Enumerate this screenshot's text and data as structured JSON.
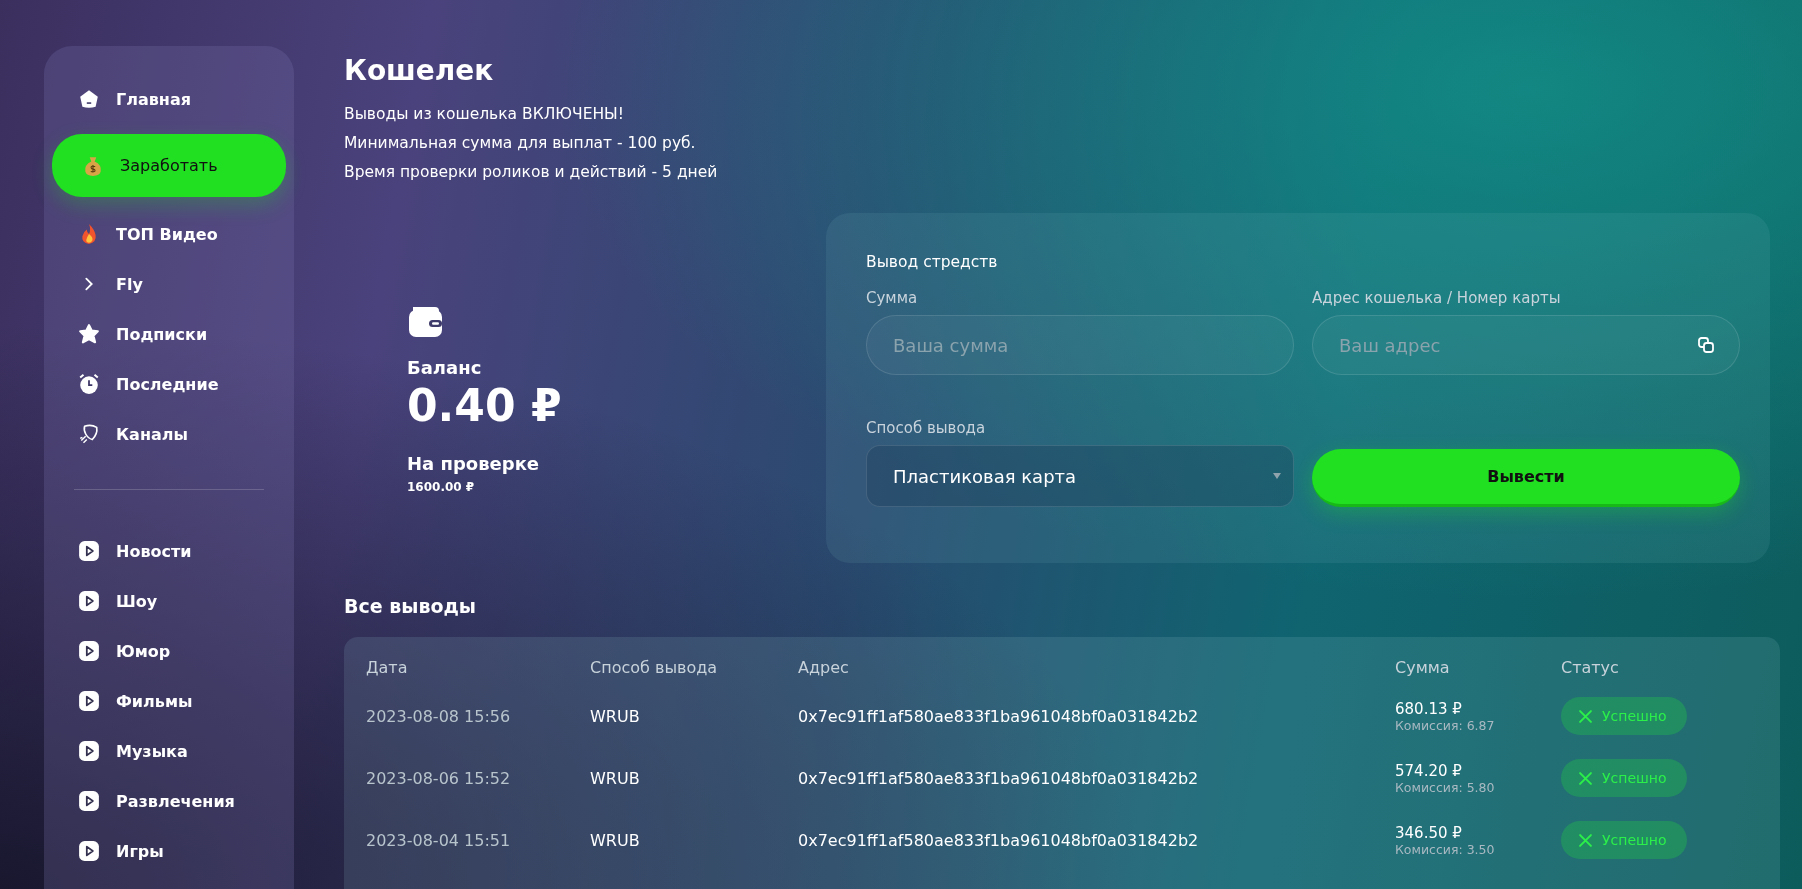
{
  "sidebar": {
    "items": [
      {
        "label": "Главная",
        "selected": false
      },
      {
        "label": "Заработать",
        "selected": true
      },
      {
        "label": "ТОП Видео",
        "selected": false
      },
      {
        "label": "Fly",
        "selected": false
      },
      {
        "label": "Подписки",
        "selected": false
      },
      {
        "label": "Последние",
        "selected": false
      },
      {
        "label": "Каналы",
        "selected": false
      }
    ],
    "categories": [
      {
        "label": "Новости",
        "selected": false
      },
      {
        "label": "Шоу",
        "selected": false
      },
      {
        "label": "Юмор",
        "selected": false
      },
      {
        "label": "Фильмы",
        "selected": false
      },
      {
        "label": "Музыка",
        "selected": false
      },
      {
        "label": "Развлечения",
        "selected": false
      },
      {
        "label": "Игры",
        "selected": false
      }
    ]
  },
  "page": {
    "title": "Кошелек",
    "notes": [
      "Выводы из кошелька ВКЛЮЧЕНЫ!",
      "Минимальная сумма для выплат - 100 руб.",
      "Время проверки роликов и действий - 5 дней"
    ]
  },
  "balance": {
    "label": "Баланс",
    "value": "0.40 ₽",
    "pending_label": "На проверке",
    "pending_value": "1600.00 ₽"
  },
  "withdraw_form": {
    "title": "Вывод стредств",
    "amount": {
      "label": "Сумма",
      "placeholder": "Ваша сумма"
    },
    "address": {
      "label": "Адрес кошелька / Номер карты",
      "placeholder": "Ваш адрес"
    },
    "method": {
      "label": "Способ вывода",
      "value": "Пластиковая карта"
    },
    "submit": "Вывести"
  },
  "withdrawals": {
    "title": "Все выводы",
    "columns": [
      "Дата",
      "Способ вывода",
      "Адрес",
      "Сумма",
      "Статус"
    ],
    "rows": [
      {
        "date": "2023-08-08 15:56",
        "method": "WRUB",
        "address": "0x7ec91ff1af580ae833f1ba961048bf0a031842b2",
        "amount": "680.13 ₽",
        "commission": "Комиссия: 6.87",
        "status": "Успешно",
        "kind": "success"
      },
      {
        "date": "2023-08-06 15:52",
        "method": "WRUB",
        "address": "0x7ec91ff1af580ae833f1ba961048bf0a031842b2",
        "amount": "574.20 ₽",
        "commission": "Комиссия: 5.80",
        "status": "Успешно",
        "kind": "success"
      },
      {
        "date": "2023-08-04 15:51",
        "method": "WRUB",
        "address": "0x7ec91ff1af580ae833f1ba961048bf0a031842b2",
        "amount": "346.50 ₽",
        "commission": "Комиссия: 3.50",
        "status": "Успешно",
        "kind": "success"
      }
    ]
  }
}
